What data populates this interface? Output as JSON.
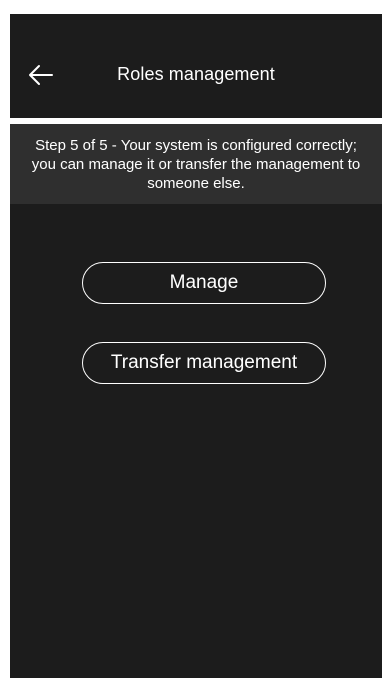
{
  "header": {
    "title": "Roles management",
    "back_icon": "arrow-left-icon"
  },
  "step_banner": {
    "text": "Step 5 of 5 -  Your system is configured correctly; you can manage it or transfer the management to someone else."
  },
  "actions": {
    "manage_label": "Manage",
    "transfer_label": "Transfer management"
  },
  "colors": {
    "background": "#1c1c1c",
    "banner": "#2f2f2f",
    "text": "#ffffff",
    "button_border": "#ffffff"
  }
}
